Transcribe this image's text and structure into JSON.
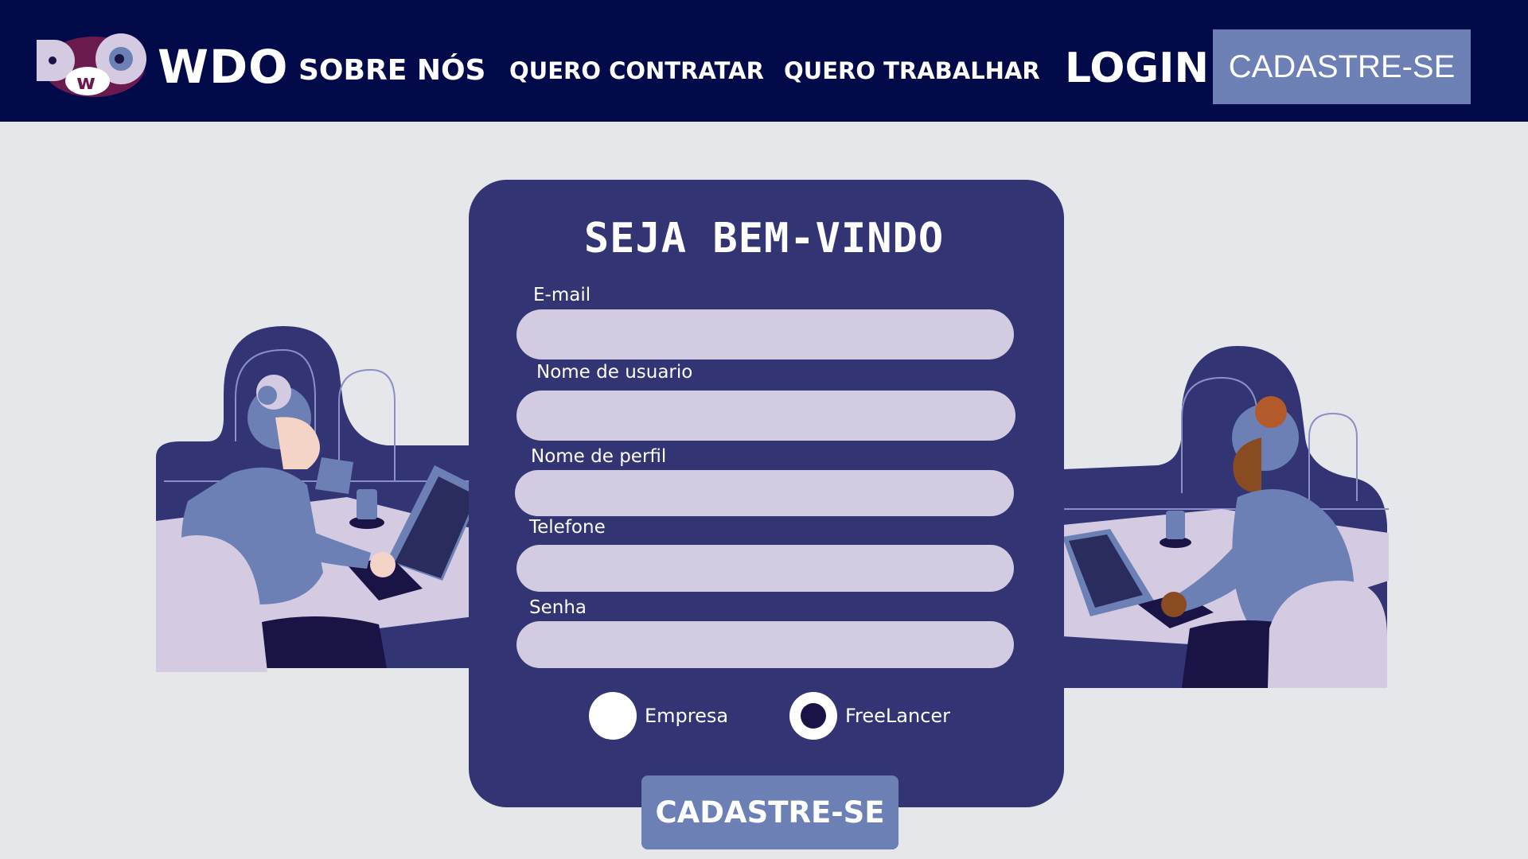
{
  "brand": {
    "logo_letters": "DwO",
    "name": "WDO"
  },
  "nav": {
    "sobre": "SOBRE NÓS",
    "contratar": "QUERO CONTRATAR",
    "trabalhar": "QUERO TRABALHAR",
    "login": "LOGIN",
    "cadastre": "CADASTRE-SE"
  },
  "form": {
    "title": "SEJA BEM-VINDO",
    "fields": [
      {
        "label": "E-mail",
        "value": ""
      },
      {
        "label": "Nome de usuario",
        "value": ""
      },
      {
        "label": "Nome de perfil",
        "value": ""
      },
      {
        "label": "Telefone",
        "value": ""
      },
      {
        "label": "Senha",
        "value": ""
      }
    ],
    "account_type": {
      "options": [
        "Empresa",
        "FreeLancer"
      ],
      "selected": "FreeLancer"
    },
    "submit": "CADASTRE-SE"
  },
  "colors": {
    "navbar": "#020a4a",
    "card": "#323474",
    "input": "#d3cbe2",
    "button": "#6c80b5",
    "page_bg": "#e6e7eb"
  }
}
